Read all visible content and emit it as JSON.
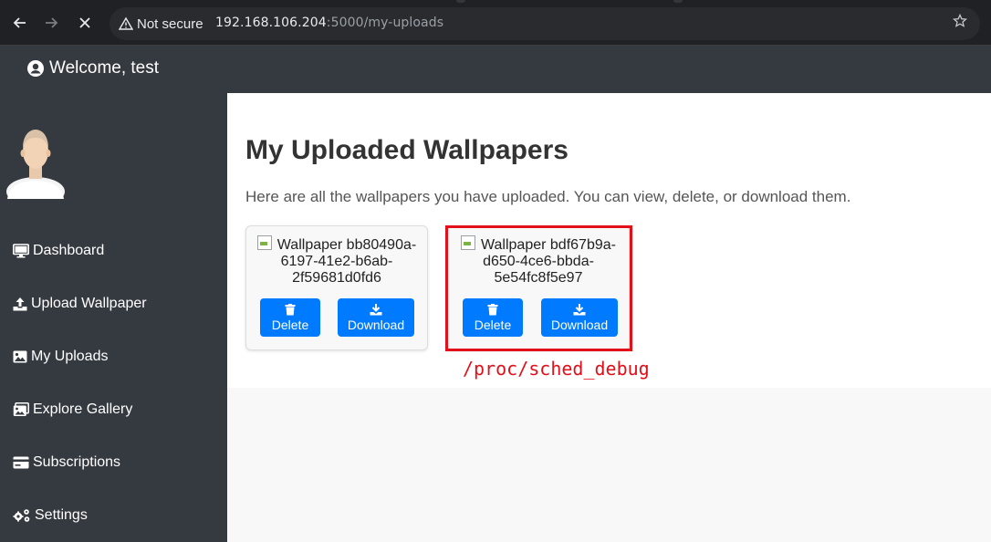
{
  "browser": {
    "security_label": "Not secure",
    "url_host": "192.168.106.204",
    "url_path": ":5000/my-uploads"
  },
  "topbar": {
    "welcome": "Welcome, test"
  },
  "sidebar": {
    "items": [
      {
        "label": "Dashboard",
        "icon": "monitor-icon"
      },
      {
        "label": "Upload Wallpaper",
        "icon": "upload-icon"
      },
      {
        "label": "My Uploads",
        "icon": "image-icon"
      },
      {
        "label": "Explore Gallery",
        "icon": "images-icon"
      },
      {
        "label": "Subscriptions",
        "icon": "credit-card-icon"
      },
      {
        "label": "Settings",
        "icon": "gears-icon"
      }
    ]
  },
  "main": {
    "title": "My Uploaded Wallpapers",
    "description": "Here are all the wallpapers you have uploaded. You can view, delete, or download them.",
    "cards": [
      {
        "alt_line1": "Wallpaper bb80490a-",
        "alt_line2": "6197-41e2-b6ab-",
        "alt_line3": "2f59681d0fd6",
        "delete_label": "Delete",
        "download_label": "Download"
      },
      {
        "alt_line1": "Wallpaper bdf67b9a-",
        "alt_line2": "d650-4ce6-bbda-",
        "alt_line3": "5e54fc8f5e97",
        "delete_label": "Delete",
        "download_label": "Download"
      }
    ]
  },
  "annotation": {
    "text": "/proc/sched_debug",
    "color": "#e3101a"
  },
  "colors": {
    "sidebar_bg": "#343a40",
    "button_primary": "#007bff"
  }
}
